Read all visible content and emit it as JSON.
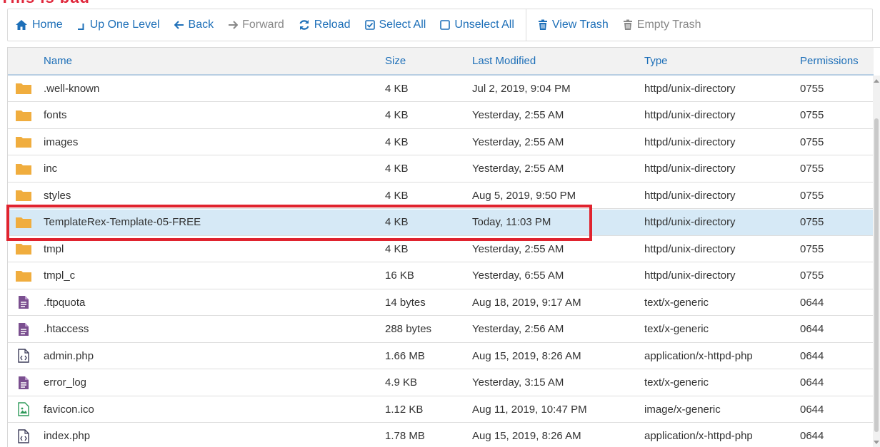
{
  "banner": "This is bad",
  "toolbar": {
    "home": "Home",
    "up": "Up One Level",
    "back": "Back",
    "forward": "Forward",
    "reload": "Reload",
    "select_all": "Select All",
    "unselect_all": "Unselect All",
    "view_trash": "View Trash",
    "empty_trash": "Empty Trash"
  },
  "columns": {
    "name": "Name",
    "size": "Size",
    "modified": "Last Modified",
    "type": "Type",
    "permissions": "Permissions"
  },
  "colors": {
    "accent": "#1d6fb8",
    "folder": "#f0ad3e",
    "file": "#7a4f8f",
    "highlight": "#e0232e",
    "selected_row": "#d6e9f6"
  },
  "files": [
    {
      "icon": "folder-icon",
      "name": ".well-known",
      "size": "4 KB",
      "modified": "Jul 2, 2019, 9:04 PM",
      "type": "httpd/unix-directory",
      "perm": "0755"
    },
    {
      "icon": "folder-icon",
      "name": "fonts",
      "size": "4 KB",
      "modified": "Yesterday, 2:55 AM",
      "type": "httpd/unix-directory",
      "perm": "0755"
    },
    {
      "icon": "folder-icon",
      "name": "images",
      "size": "4 KB",
      "modified": "Yesterday, 2:55 AM",
      "type": "httpd/unix-directory",
      "perm": "0755"
    },
    {
      "icon": "folder-icon",
      "name": "inc",
      "size": "4 KB",
      "modified": "Yesterday, 2:55 AM",
      "type": "httpd/unix-directory",
      "perm": "0755"
    },
    {
      "icon": "folder-icon",
      "name": "styles",
      "size": "4 KB",
      "modified": "Aug 5, 2019, 9:50 PM",
      "type": "httpd/unix-directory",
      "perm": "0755"
    },
    {
      "icon": "folder-icon",
      "name": "TemplateRex-Template-05-FREE",
      "size": "4 KB",
      "modified": "Today, 11:03 PM",
      "type": "httpd/unix-directory",
      "perm": "0755"
    },
    {
      "icon": "folder-icon",
      "name": "tmpl",
      "size": "4 KB",
      "modified": "Yesterday, 2:55 AM",
      "type": "httpd/unix-directory",
      "perm": "0755"
    },
    {
      "icon": "folder-icon",
      "name": "tmpl_c",
      "size": "16 KB",
      "modified": "Yesterday, 6:55 AM",
      "type": "httpd/unix-directory",
      "perm": "0755"
    },
    {
      "icon": "text-file-icon",
      "name": ".ftpquota",
      "size": "14 bytes",
      "modified": "Aug 18, 2019, 9:17 AM",
      "type": "text/x-generic",
      "perm": "0644"
    },
    {
      "icon": "text-file-icon",
      "name": ".htaccess",
      "size": "288 bytes",
      "modified": "Yesterday, 2:56 AM",
      "type": "text/x-generic",
      "perm": "0644"
    },
    {
      "icon": "code-file-icon",
      "name": "admin.php",
      "size": "1.66 MB",
      "modified": "Aug 15, 2019, 8:26 AM",
      "type": "application/x-httpd-php",
      "perm": "0644"
    },
    {
      "icon": "text-file-icon",
      "name": "error_log",
      "size": "4.9 KB",
      "modified": "Yesterday, 3:15 AM",
      "type": "text/x-generic",
      "perm": "0644"
    },
    {
      "icon": "image-file-icon",
      "name": "favicon.ico",
      "size": "1.12 KB",
      "modified": "Aug 11, 2019, 10:47 PM",
      "type": "image/x-generic",
      "perm": "0644"
    },
    {
      "icon": "code-file-icon",
      "name": "index.php",
      "size": "1.78 MB",
      "modified": "Aug 15, 2019, 8:26 AM",
      "type": "application/x-httpd-php",
      "perm": "0644"
    }
  ]
}
